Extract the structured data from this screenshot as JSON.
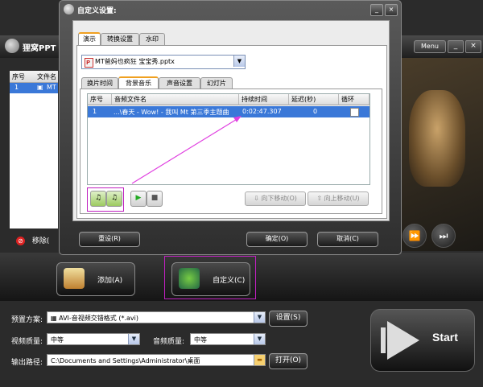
{
  "main": {
    "app_name": "狸窝PPT",
    "menu_label": "Menu",
    "list_headers": [
      "序号",
      "文件名"
    ],
    "list_row": {
      "index": "1",
      "name": "MT"
    },
    "delete_label": "移除(",
    "add_label": "添加(A)",
    "custom_label": "自定义(C)",
    "preset_label": "预置方案:",
    "preset_value": "AVI-音视频交错格式 (*.avi)",
    "settings_label": "设置(S)",
    "video_quality_label": "视频质量:",
    "video_quality_value": "中等",
    "audio_quality_label": "音频质量:",
    "audio_quality_value": "中等",
    "output_label": "输出路径:",
    "output_value": "C:\\Documents and Settings\\Administrator\\桌面",
    "open_label": "打开(O)",
    "start_label": "Start"
  },
  "dialog": {
    "title": "自定义设置:",
    "tabs_top": [
      "演示",
      "转换设置",
      "水印"
    ],
    "file_select": "MT爸妈也疯狂 宝宝秀.pptx",
    "tabs_sub": [
      "换片时间",
      "背景音乐",
      "声音设置",
      "幻灯片"
    ],
    "columns": [
      "序号",
      "音频文件名",
      "持续时间",
      "延迟(秒)",
      "循环"
    ],
    "row": {
      "index": "1",
      "name": "...\\春天 - Wow! - 我叫 Mt 第三季主题曲",
      "duration": "0:02:47.307",
      "delay": "0"
    },
    "move_down": "向下移动(O)",
    "move_up": "向上移动(U)",
    "reset": "重设(R)",
    "ok": "确定(O)",
    "cancel": "取消(C)"
  },
  "colors": {
    "accent": "#3a78d8",
    "highlight": "#c020c0"
  }
}
